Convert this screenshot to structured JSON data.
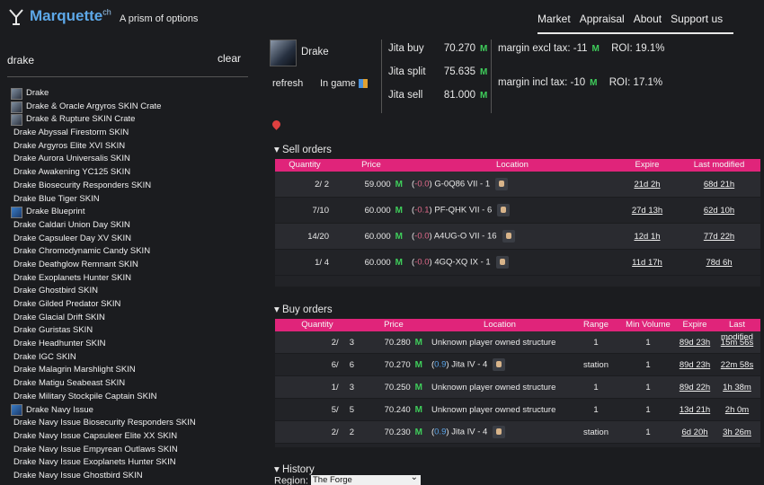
{
  "header": {
    "brand": "Marquette",
    "brand_sup": "ch",
    "tagline": "A prism of options",
    "nav": [
      "Market",
      "Appraisal",
      "About",
      "Support us"
    ]
  },
  "sidebar": {
    "search_value": "drake",
    "clear_label": "clear",
    "results": [
      {
        "label": "Drake",
        "thumb": "ship"
      },
      {
        "label": "Drake & Oracle Argyros SKIN Crate",
        "thumb": "ship"
      },
      {
        "label": "Drake & Rupture SKIN Crate",
        "thumb": "ship"
      },
      {
        "label": "Drake Abyssal Firestorm SKIN",
        "thumb": ""
      },
      {
        "label": "Drake Argyros Elite XVI SKIN",
        "thumb": ""
      },
      {
        "label": "Drake Aurora Universalis SKIN",
        "thumb": ""
      },
      {
        "label": "Drake Awakening YC125 SKIN",
        "thumb": ""
      },
      {
        "label": "Drake Biosecurity Responders SKIN",
        "thumb": ""
      },
      {
        "label": "Drake Blue Tiger SKIN",
        "thumb": ""
      },
      {
        "label": "Drake Blueprint",
        "thumb": "bp"
      },
      {
        "label": "Drake Caldari Union Day SKIN",
        "thumb": ""
      },
      {
        "label": "Drake Capsuleer Day XV SKIN",
        "thumb": ""
      },
      {
        "label": "Drake Chromodynamic Candy SKIN",
        "thumb": ""
      },
      {
        "label": "Drake Deathglow Remnant SKIN",
        "thumb": ""
      },
      {
        "label": "Drake Exoplanets Hunter SKIN",
        "thumb": ""
      },
      {
        "label": "Drake Ghostbird SKIN",
        "thumb": ""
      },
      {
        "label": "Drake Gilded Predator SKIN",
        "thumb": ""
      },
      {
        "label": "Drake Glacial Drift SKIN",
        "thumb": ""
      },
      {
        "label": "Drake Guristas SKIN",
        "thumb": ""
      },
      {
        "label": "Drake Headhunter SKIN",
        "thumb": ""
      },
      {
        "label": "Drake IGC SKIN",
        "thumb": ""
      },
      {
        "label": "Drake Malagrin Marshlight SKIN",
        "thumb": ""
      },
      {
        "label": "Drake Matigu Seabeast SKIN",
        "thumb": ""
      },
      {
        "label": "Drake Military Stockpile Captain SKIN",
        "thumb": ""
      },
      {
        "label": "Drake Navy Issue",
        "thumb": "bp"
      },
      {
        "label": "Drake Navy Issue Biosecurity Responders SKIN",
        "thumb": ""
      },
      {
        "label": "Drake Navy Issue Capsuleer Elite XX SKIN",
        "thumb": ""
      },
      {
        "label": "Drake Navy Issue Empyrean Outlaws SKIN",
        "thumb": ""
      },
      {
        "label": "Drake Navy Issue Exoplanets Hunter SKIN",
        "thumb": ""
      },
      {
        "label": "Drake Navy Issue Ghostbird SKIN",
        "thumb": ""
      }
    ]
  },
  "item": {
    "name": "Drake",
    "refresh_label": "refresh",
    "ingame_label": "In game",
    "jita_buy_label": "Jita buy",
    "jita_buy": "70.270",
    "jita_split_label": "Jita split",
    "jita_split": "75.635",
    "jita_sell_label": "Jita sell",
    "jita_sell": "81.000",
    "isk_unit": "M",
    "margin_excl_label": "margin excl tax:",
    "margin_excl": "-11",
    "roi_excl": "ROI: 19.1%",
    "margin_incl_label": "margin incl tax:",
    "margin_incl": "-10",
    "roi_incl": "ROI: 17.1%"
  },
  "sell_orders": {
    "title": "▾ Sell orders",
    "headers": [
      "Quantity",
      "Price",
      "Location",
      "Expire",
      "Last modified"
    ],
    "rows": [
      {
        "qty": "2/  2",
        "price": "59.000",
        "sec": "-0.0",
        "loc": "G-0Q86 VII - 1",
        "expire": "21d 2h",
        "modified": "68d 21h"
      },
      {
        "qty": "7/10",
        "price": "60.000",
        "sec": "-0.1",
        "loc": "PF-QHK VII - 6",
        "expire": "27d 13h",
        "modified": "62d 10h"
      },
      {
        "qty": "14/20",
        "price": "60.000",
        "sec": "-0.0",
        "loc": "A4UG-O VII - 16",
        "expire": "12d 1h",
        "modified": "77d 22h"
      },
      {
        "qty": "1/  4",
        "price": "60.000",
        "sec": "-0.0",
        "loc": "4GQ-XQ IX - 1",
        "expire": "11d 17h",
        "modified": "78d 6h"
      }
    ]
  },
  "buy_orders": {
    "title": "▾ Buy orders",
    "headers": [
      "Quantity",
      "Price",
      "Location",
      "Range",
      "Min Volume",
      "Expire",
      "Last modified"
    ],
    "rows": [
      {
        "qty": "2/",
        "qty2": "3",
        "price": "70.280",
        "sec": "",
        "loc": "Unknown player owned structure",
        "range": "1",
        "minvol": "1",
        "expire": "89d 23h",
        "modified": "15m 56s"
      },
      {
        "qty": "6/",
        "qty2": "6",
        "price": "70.270",
        "sec": "0.9",
        "loc": "Jita IV - 4",
        "range": "station",
        "minvol": "1",
        "expire": "89d 23h",
        "modified": "22m 58s"
      },
      {
        "qty": "1/",
        "qty2": "3",
        "price": "70.250",
        "sec": "",
        "loc": "Unknown player owned structure",
        "range": "1",
        "minvol": "1",
        "expire": "89d 22h",
        "modified": "1h 38m"
      },
      {
        "qty": "5/",
        "qty2": "5",
        "price": "70.240",
        "sec": "",
        "loc": "Unknown player owned structure",
        "range": "1",
        "minvol": "1",
        "expire": "13d 21h",
        "modified": "2h 0m"
      },
      {
        "qty": "2/",
        "qty2": "2",
        "price": "70.230",
        "sec": "0.9",
        "loc": "Jita IV - 4",
        "range": "station",
        "minvol": "1",
        "expire": "6d 20h",
        "modified": "3h 26m"
      }
    ]
  },
  "history": {
    "title": "▾ History",
    "region_label": "Region:",
    "region_value": "The Forge"
  }
}
